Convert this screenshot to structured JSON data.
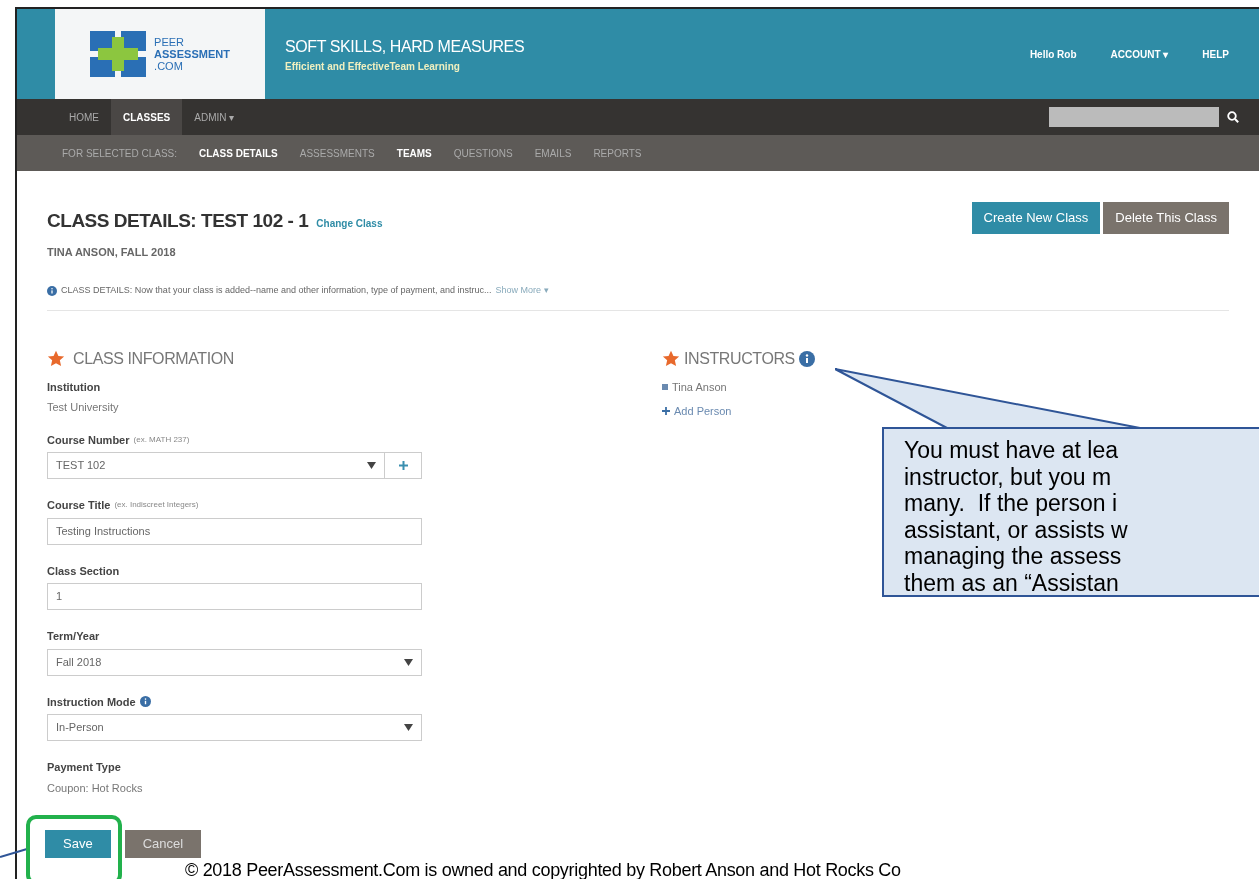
{
  "header": {
    "logo": [
      "PEER",
      "ASSESSMENT",
      ".COM"
    ],
    "tagline": "SOFT SKILLS, HARD MEASURES",
    "subtagline": "Efficient and EffectiveTeam Learning",
    "links": [
      "Hello Rob",
      "ACCOUNT ▾",
      "HELP"
    ]
  },
  "nav": {
    "items": [
      {
        "label": "HOME",
        "selected": false
      },
      {
        "label": "CLASSES",
        "selected": true
      },
      {
        "label": "ADMIN ▾",
        "selected": false
      }
    ]
  },
  "subnav": {
    "label": "FOR SELECTED CLASS:",
    "items": [
      {
        "label": "CLASS DETAILS",
        "highlighted": true
      },
      {
        "label": "ASSESSMENTS",
        "highlighted": false
      },
      {
        "label": "TEAMS",
        "highlighted": true
      },
      {
        "label": "QUESTIONS",
        "highlighted": false
      },
      {
        "label": "EMAILS",
        "highlighted": false
      },
      {
        "label": "REPORTS",
        "highlighted": false
      }
    ]
  },
  "page": {
    "title": "CLASS DETAILS: TEST 102 - 1",
    "change_link": "Change Class",
    "subtitle": "TINA ANSON, FALL 2018",
    "buttons": [
      {
        "label": "Create New Class",
        "kind": "primary"
      },
      {
        "label": "Delete This Class",
        "kind": "secondary"
      }
    ],
    "info": "CLASS DETAILS: Now that your class is added--name and other information, type of payment, and instruc...",
    "show_more": "Show More ▾"
  },
  "class_information": {
    "heading": "CLASS INFORMATION",
    "fields": [
      {
        "kind": "static",
        "label": "Institution",
        "value": "Test University"
      },
      {
        "kind": "select_add",
        "label": "Course Number",
        "hint": "(ex. MATH 237)",
        "value": "TEST 102"
      },
      {
        "kind": "text",
        "label": "Course Title",
        "hint": "(ex. Indiscreet Integers)",
        "value": "Testing Instructions"
      },
      {
        "kind": "text",
        "label": "Class Section",
        "value": "1"
      },
      {
        "kind": "select",
        "label": "Term/Year",
        "value": "Fall 2018"
      },
      {
        "kind": "select",
        "label": "Instruction Mode",
        "info": true,
        "value": "In-Person"
      },
      {
        "kind": "static",
        "label": "Payment Type",
        "value": "Coupon: Hot Rocks"
      }
    ]
  },
  "instructors": {
    "heading": "INSTRUCTORS",
    "people": [
      "Tina Anson"
    ],
    "add": "Add Person"
  },
  "actions": [
    {
      "label": "Save",
      "kind": "primary"
    },
    {
      "label": "Cancel",
      "kind": "secondary"
    }
  ],
  "callout": {
    "lines": [
      "You must have at lea",
      "instructor, but you m",
      "many.  If the person i",
      "assistant, or assists w",
      "managing the assess",
      "them as an “Assistan"
    ]
  },
  "copyright": "© 2018 PeerAssessment.Com is owned and copyrighted by Robert Anson and Hot Rocks Co"
}
